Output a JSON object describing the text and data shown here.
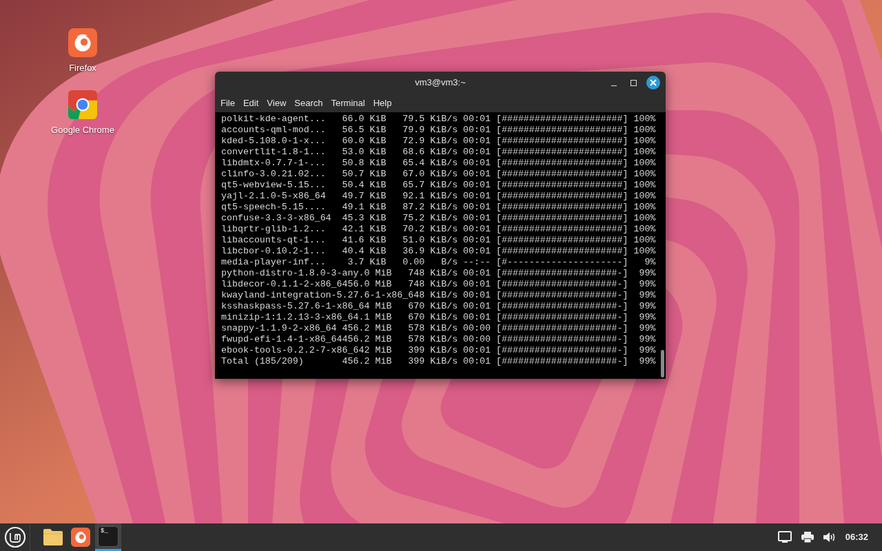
{
  "desktop": {
    "icons": [
      {
        "label": "Firefox",
        "kind": "firefox"
      },
      {
        "label": "Google Chrome",
        "kind": "chrome"
      }
    ]
  },
  "terminal": {
    "title": "vm3@vm3:~",
    "menu": [
      "File",
      "Edit",
      "View",
      "Search",
      "Terminal",
      "Help"
    ],
    "lines": [
      "polkit-kde-agent...   66.0 KiB   79.5 KiB/s 00:01 [######################] 100%",
      "accounts-qml-mod...   56.5 KiB   79.9 KiB/s 00:01 [######################] 100%",
      "kded-5.108.0-1-x...   60.0 KiB   72.9 KiB/s 00:01 [######################] 100%",
      "convertlit-1.8-1...   53.0 KiB   68.6 KiB/s 00:01 [######################] 100%",
      "libdmtx-0.7.7-1-...   50.8 KiB   65.4 KiB/s 00:01 [######################] 100%",
      "clinfo-3.0.21.02...   50.7 KiB   67.0 KiB/s 00:01 [######################] 100%",
      "qt5-webview-5.15...   50.4 KiB   65.7 KiB/s 00:01 [######################] 100%",
      "yajl-2.1.0-5-x86_64   49.7 KiB   92.1 KiB/s 00:01 [######################] 100%",
      "qt5-speech-5.15....   49.1 KiB   87.2 KiB/s 00:01 [######################] 100%",
      "confuse-3.3-3-x86_64  45.3 KiB   75.2 KiB/s 00:01 [######################] 100%",
      "libqrtr-glib-1.2...   42.1 KiB   70.2 KiB/s 00:01 [######################] 100%",
      "libaccounts-qt-1...   41.6 KiB   51.0 KiB/s 00:01 [######################] 100%",
      "libcbor-0.10.2-1...   40.4 KiB   36.9 KiB/s 00:01 [######################] 100%",
      "media-player-inf...    3.7 KiB   0.00   B/s --:-- [#---------------------]   9%",
      "python-distro-1.8.0-3-any.0 MiB   748 KiB/s 00:01 [#####################-]  99%",
      "libdecor-0.1.1-2-x86_6456.0 MiB   748 KiB/s 00:01 [#####################-]  99%",
      "kwayland-integration-5.27.6-1-x86_648 KiB/s 00:01 [#####################-]  99%",
      "ksshaskpass-5.27.6-1-x86_64 MiB   670 KiB/s 00:01 [#####################-]  99%",
      "minizip-1:1.2.13-3-x86_64.1 MiB   670 KiB/s 00:01 [#####################-]  99%",
      "snappy-1.1.9-2-x86_64 456.2 MiB   578 KiB/s 00:00 [#####################-]  99%",
      "fwupd-efi-1.4-1-x86_64456.2 MiB   578 KiB/s 00:00 [#####################-]  99%",
      "ebook-tools-0.2.2-7-x86_642 MiB   399 KiB/s 00:01 [#####################-]  99%",
      "Total (185/209)       456.2 MiB   399 KiB/s 00:01 [#####################-]  99%"
    ]
  },
  "taskbar": {
    "apps": [
      {
        "kind": "files",
        "selected": false
      },
      {
        "kind": "firefox",
        "selected": false
      },
      {
        "kind": "terminal",
        "selected": true,
        "glyph": "$_"
      }
    ],
    "tray": [
      {
        "kind": "network"
      },
      {
        "kind": "printer"
      },
      {
        "kind": "volume"
      }
    ],
    "clock": "06:32"
  }
}
